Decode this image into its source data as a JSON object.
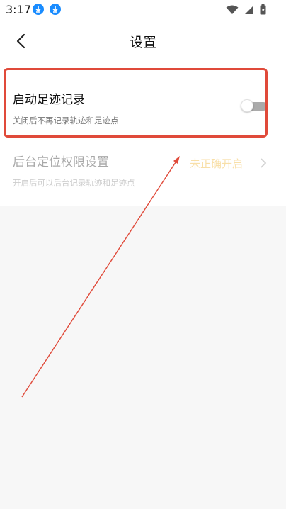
{
  "status_bar": {
    "time": "3:17",
    "icons": [
      "download-icon",
      "download-icon",
      "wifi-icon",
      "signal-icon",
      "battery-icon"
    ]
  },
  "nav": {
    "title": "设置",
    "back_icon": "chevron-left-icon"
  },
  "settings": {
    "footprint": {
      "title": "启动足迹记录",
      "subtitle": "关闭后不再记录轨迹和足迹点",
      "enabled": false
    },
    "background_location": {
      "title": "后台定位权限设置",
      "subtitle": "开启后可以后台记录轨迹和足迹点",
      "status": "未正确开启",
      "status_color": "#f0b431"
    }
  },
  "annotation": {
    "color": "#e04a3a"
  }
}
